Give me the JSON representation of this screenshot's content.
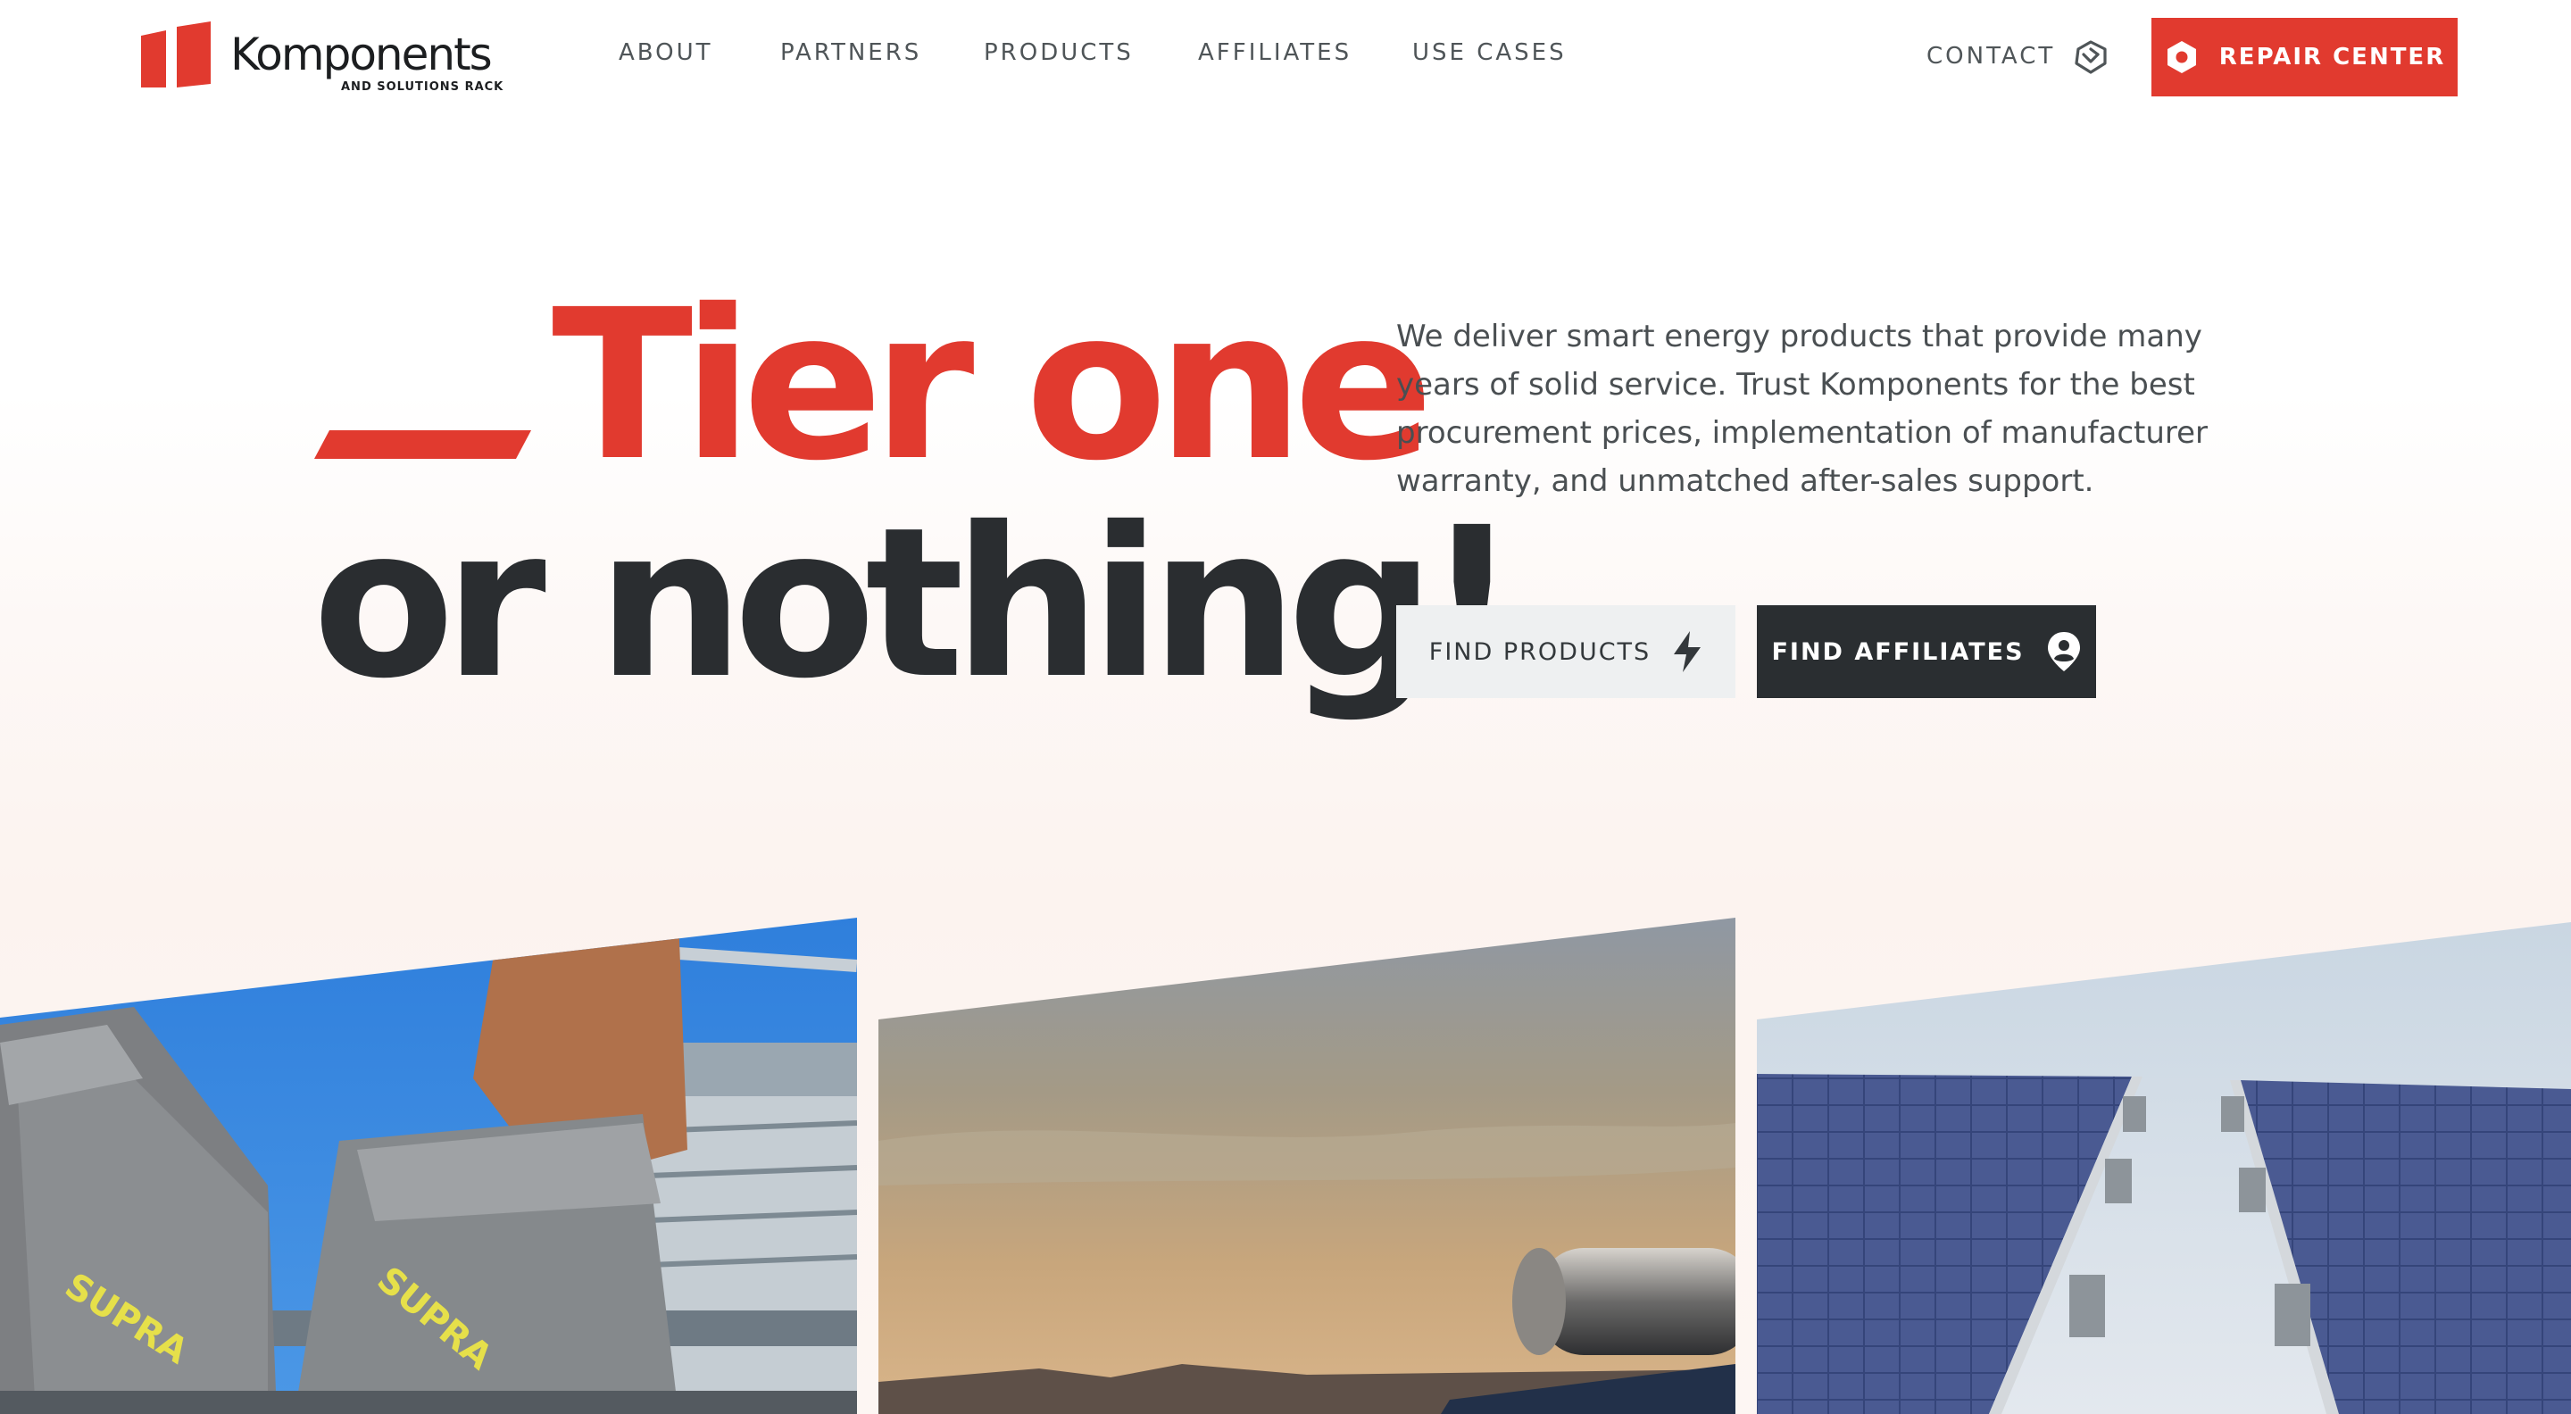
{
  "brand": {
    "name": "Komponents",
    "tagline": "AND SOLUTIONS RACK",
    "accent_color": "#e13a2f",
    "dark_color": "#2a2d30"
  },
  "nav": {
    "items": [
      {
        "label": "ABOUT"
      },
      {
        "label": "PARTNERS"
      },
      {
        "label": "PRODUCTS"
      },
      {
        "label": "AFFILIATES"
      },
      {
        "label": "USE CASES"
      }
    ],
    "contact": {
      "label": "CONTACT",
      "icon": "handshake-icon"
    },
    "repair": {
      "label": "REPAIR CENTER",
      "icon": "hexagon-nut-icon"
    }
  },
  "hero": {
    "headline_line1": "Tier one",
    "headline_line2": "or nothing!",
    "description": "We deliver smart energy products that provide many years of solid service. Trust Komponents for the best procurement prices, implementation of manufacturer warranty, and unmatched after-sales support.",
    "buttons": {
      "products": {
        "label": "FIND PRODUCTS",
        "icon": "lightning-bolt-icon"
      },
      "affiliates": {
        "label": "FIND AFFILIATES",
        "icon": "location-person-icon"
      }
    }
  },
  "gallery": [
    {
      "subject": "gloved-hands-photo"
    },
    {
      "subject": "sunset-solar-water-heater-photo"
    },
    {
      "subject": "solar-panels-photo"
    }
  ]
}
